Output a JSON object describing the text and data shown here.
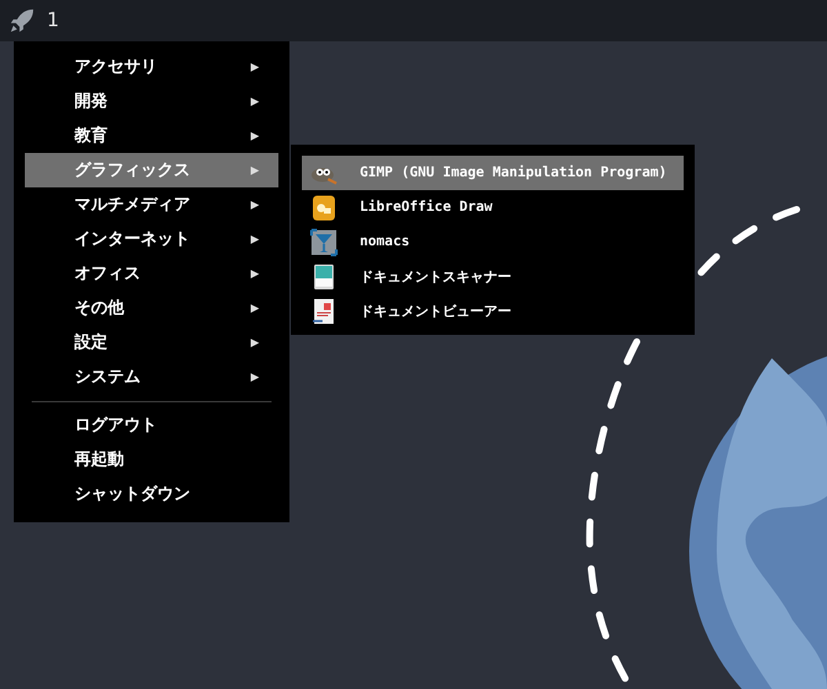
{
  "panel": {
    "workspace": "1"
  },
  "main_menu": {
    "sections": [
      [
        {
          "label": "アクセサリ",
          "arrow": "▶",
          "selected": false
        },
        {
          "label": "開発",
          "arrow": "▶",
          "selected": false
        },
        {
          "label": "教育",
          "arrow": "▶",
          "selected": false
        },
        {
          "label": "グラフィックス",
          "arrow": "▶",
          "selected": true
        },
        {
          "label": "マルチメディア",
          "arrow": "▶",
          "selected": false
        },
        {
          "label": "インターネット",
          "arrow": "▶",
          "selected": false
        },
        {
          "label": "オフィス",
          "arrow": "▶",
          "selected": false
        },
        {
          "label": "その他",
          "arrow": "▶",
          "selected": false
        },
        {
          "label": "設定",
          "arrow": "▶",
          "selected": false
        },
        {
          "label": "システム",
          "arrow": "▶",
          "selected": false
        }
      ],
      [
        {
          "label": "ログアウト",
          "selected": false
        },
        {
          "label": "再起動",
          "selected": false
        },
        {
          "label": "シャットダウン",
          "selected": false
        }
      ]
    ]
  },
  "submenu": {
    "items": [
      {
        "label": "GIMP (GNU Image Manipulation Program)",
        "selected": true
      },
      {
        "label": "LibreOffice Draw",
        "selected": false
      },
      {
        "label": "nomacs",
        "selected": false
      },
      {
        "label": "ドキュメントスキャナー",
        "selected": false
      },
      {
        "label": "ドキュメントビューアー",
        "selected": false
      }
    ]
  }
}
